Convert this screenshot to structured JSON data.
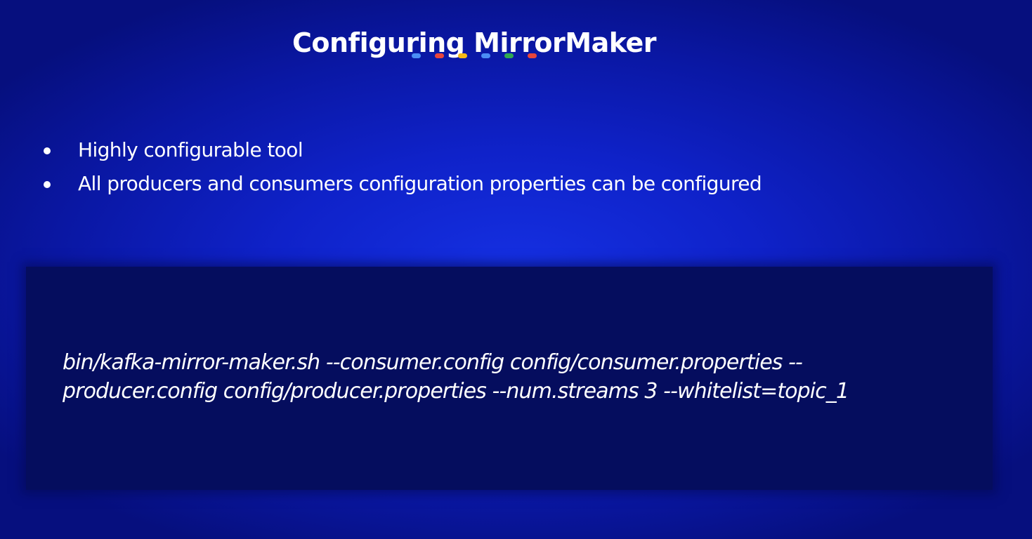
{
  "slide": {
    "title": "Configuring MirrorMaker",
    "accent_dots": [
      {
        "name": "blue-dot",
        "color": "#4a8df5"
      },
      {
        "name": "red-dot",
        "color": "#e8453c"
      },
      {
        "name": "yellow-dot",
        "color": "#f5b915"
      },
      {
        "name": "blue-dot",
        "color": "#4a8df5"
      },
      {
        "name": "green-dot",
        "color": "#2fa853"
      },
      {
        "name": "red-dot",
        "color": "#e8453c"
      }
    ],
    "bullets": [
      "Highly configurable tool",
      "All producers and consumers configuration properties can be configured"
    ],
    "code": {
      "lines": [
        "bin/kafka-mirror-maker.sh --consumer.config config/consumer.properties --",
        "producer.config config/producer.properties --num.streams 3 --whitelist=topic_1"
      ]
    }
  },
  "colors": {
    "background": "#0f22c9",
    "code_background": "#050d5e",
    "text": "#ffffff"
  }
}
